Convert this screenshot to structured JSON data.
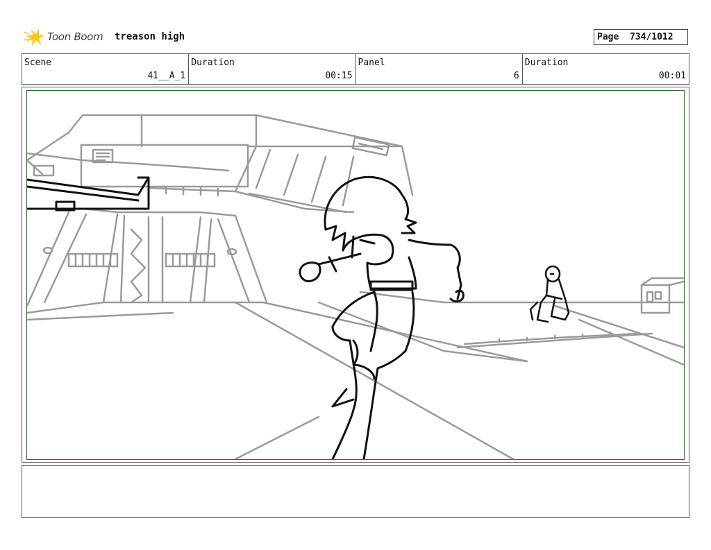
{
  "header": {
    "logo_text": "Toon Boom",
    "project_title": "treason high",
    "page": "Page  734/1012"
  },
  "info": {
    "scene_label": "Scene",
    "scene_value": "41__A_1",
    "scene_duration_label": "Duration",
    "scene_duration_value": "00:15",
    "panel_label": "Panel",
    "panel_value": "6",
    "panel_duration_label": "Duration",
    "panel_duration_value": "00:01"
  },
  "notes": {
    "text": ""
  },
  "colors": {
    "logo_accent": "#f5c518",
    "safe_area_border": "#2f6a2f",
    "background_lines": "#9a9a9a",
    "character_lines": "#111111"
  }
}
